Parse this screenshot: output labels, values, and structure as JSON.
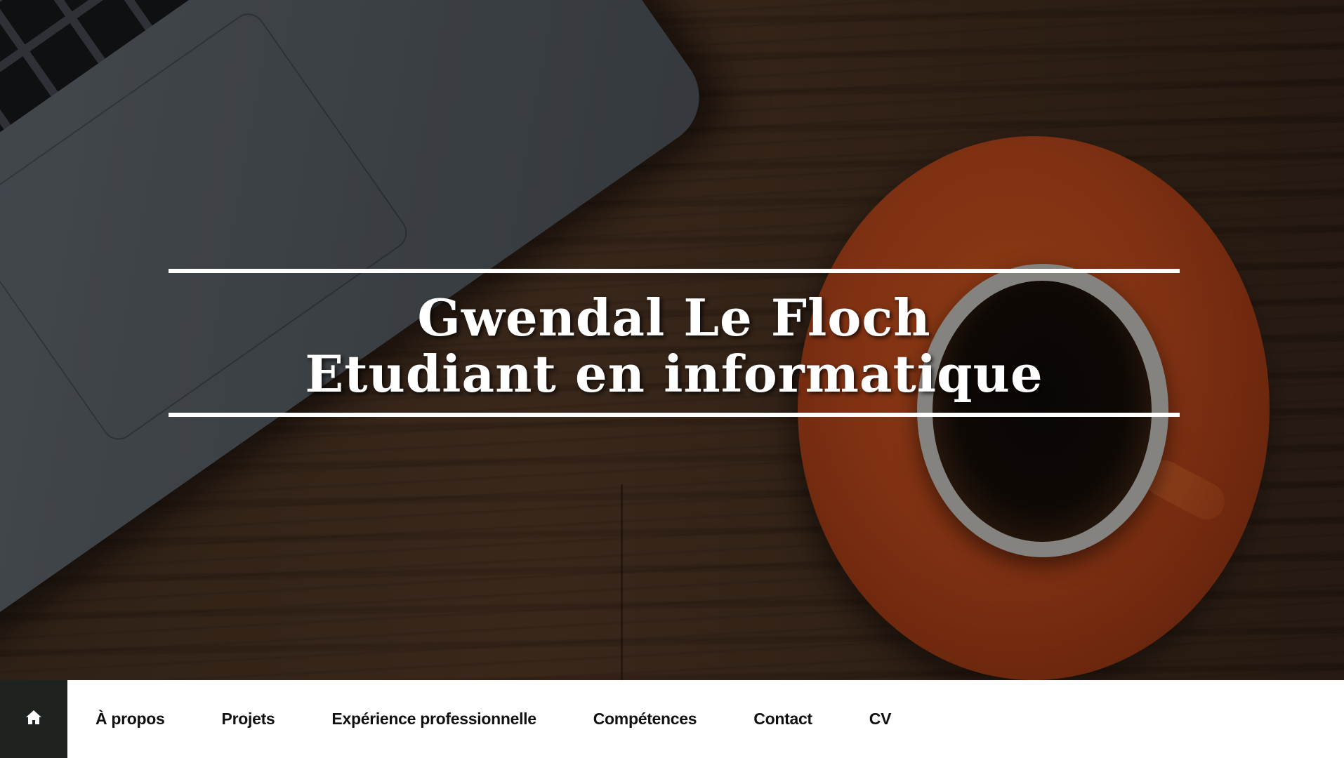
{
  "hero": {
    "name": "Gwendal Le Floch",
    "subtitle": "Etudiant en informatique",
    "background_icon": "laptop-coffee-photo"
  },
  "nav": {
    "home_icon": "home-icon",
    "items": [
      {
        "label": "À propos"
      },
      {
        "label": "Projets"
      },
      {
        "label": "Expérience professionnelle"
      },
      {
        "label": "Compétences"
      },
      {
        "label": "Contact"
      },
      {
        "label": "CV"
      }
    ]
  },
  "colors": {
    "nav_background": "#ffffff",
    "home_button": "#1e231f",
    "title_text": "#ffffff",
    "nav_text": "#111111"
  }
}
